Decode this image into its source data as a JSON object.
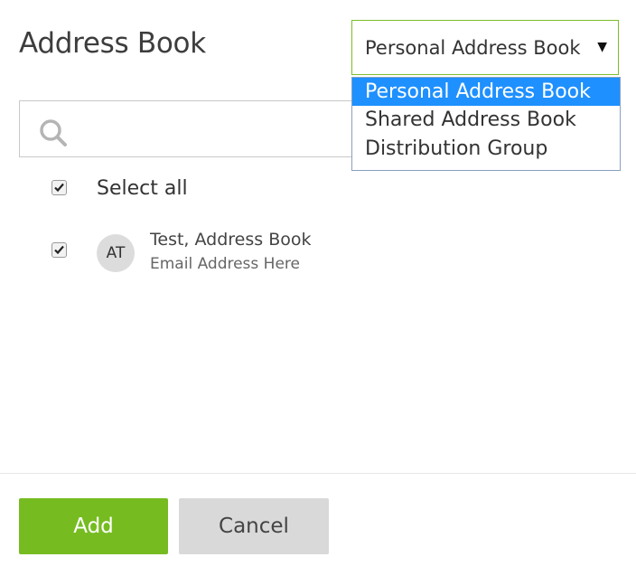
{
  "dialog": {
    "title": "Address Book"
  },
  "book_select": {
    "selected": "Personal Address Book",
    "options": [
      {
        "label": "Personal Address Book"
      },
      {
        "label": "Shared Address Book"
      },
      {
        "label": "Distribution Group"
      }
    ]
  },
  "search": {
    "value": "",
    "placeholder": ""
  },
  "select_all": {
    "label": "Select all",
    "checked": true
  },
  "contacts": [
    {
      "initials": "AT",
      "name": "Test, Address Book",
      "email": "Email Address Here",
      "checked": true
    }
  ],
  "footer": {
    "add_label": "Add",
    "cancel_label": "Cancel"
  },
  "colors": {
    "accent_green": "#76bc21",
    "highlight_blue": "#1e90ff",
    "cancel_gray": "#d9d9d9"
  }
}
